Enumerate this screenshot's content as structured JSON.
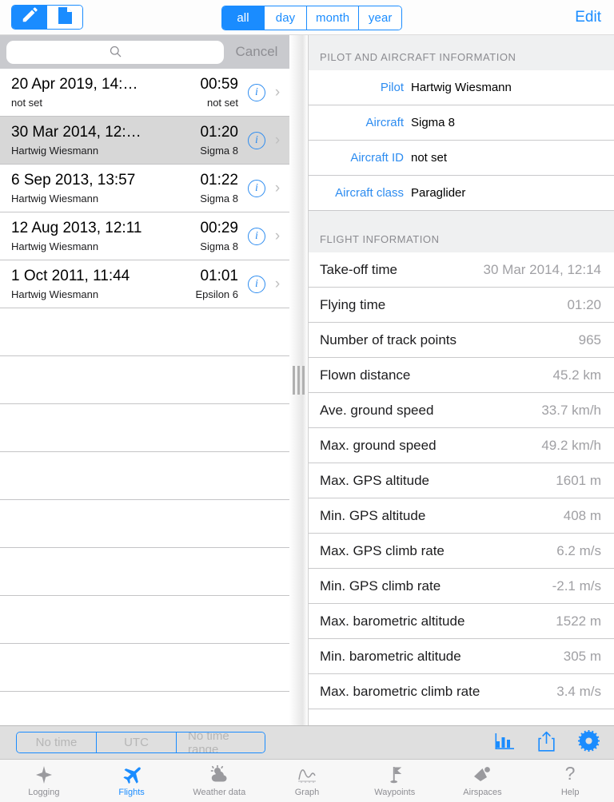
{
  "topbar": {
    "mode_segments": [
      {
        "icon": "pencil-icon",
        "selected": true
      },
      {
        "icon": "document-icon",
        "selected": false
      }
    ],
    "period_segments": [
      {
        "label": "all",
        "selected": true
      },
      {
        "label": "day",
        "selected": false
      },
      {
        "label": "month",
        "selected": false
      },
      {
        "label": "year",
        "selected": false
      }
    ],
    "edit_label": "Edit",
    "accent_color": "#1a8cff"
  },
  "search": {
    "value": "",
    "placeholder": "",
    "icon": "search-icon",
    "cancel_label": "Cancel"
  },
  "flight_list": {
    "rows": [
      {
        "title": "20 Apr 2019, 14:…",
        "subtitle": "not set",
        "duration": "00:59",
        "aircraft": "not set",
        "selected": false
      },
      {
        "title": "30 Mar 2014, 12:…",
        "subtitle": "Hartwig Wiesmann",
        "duration": "01:20",
        "aircraft": "Sigma 8",
        "selected": true
      },
      {
        "title": "6 Sep 2013, 13:57",
        "subtitle": "Hartwig Wiesmann",
        "duration": "01:22",
        "aircraft": "Sigma 8",
        "selected": false
      },
      {
        "title": "12 Aug 2013, 12:11",
        "subtitle": "Hartwig Wiesmann",
        "duration": "00:29",
        "aircraft": "Sigma 8",
        "selected": false
      },
      {
        "title": "1 Oct 2011, 11:44",
        "subtitle": "Hartwig Wiesmann",
        "duration": "01:01",
        "aircraft": "Epsilon 6",
        "selected": false
      }
    ],
    "empty_row_count": 9,
    "info_icon": "info-circle-icon",
    "chevron_icon": "chevron-right-icon",
    "selected_row_color": "#d7d7d7"
  },
  "detail": {
    "pilot_section": {
      "header": "PILOT AND AIRCRAFT INFORMATION",
      "rows": [
        {
          "label": "Pilot",
          "value": "Hartwig Wiesmann"
        },
        {
          "label": "Aircraft",
          "value": "Sigma 8"
        },
        {
          "label": "Aircraft ID",
          "value": "not set"
        },
        {
          "label": "Aircraft class",
          "value": "Paraglider"
        }
      ]
    },
    "flight_section": {
      "header": "FLIGHT INFORMATION",
      "rows": [
        {
          "label": "Take-off time",
          "value": "30 Mar 2014, 12:14"
        },
        {
          "label": "Flying time",
          "value": "01:20"
        },
        {
          "label": "Number of track points",
          "value": "965"
        },
        {
          "label": "Flown distance",
          "value": "45.2 km"
        },
        {
          "label": "Ave. ground speed",
          "value": "33.7 km/h"
        },
        {
          "label": "Max. ground speed",
          "value": "49.2 km/h"
        },
        {
          "label": "Max. GPS altitude",
          "value": "1601 m"
        },
        {
          "label": "Min. GPS altitude",
          "value": "408 m"
        },
        {
          "label": "Max. GPS climb rate",
          "value": "6.2 m/s"
        },
        {
          "label": "Min. GPS climb rate",
          "value": "-2.1 m/s"
        },
        {
          "label": "Max. barometric altitude",
          "value": "1522 m"
        },
        {
          "label": "Min. barometric altitude",
          "value": "305 m"
        },
        {
          "label": "Max. barometric climb rate",
          "value": "3.4 m/s"
        }
      ]
    }
  },
  "bottom_toolbar": {
    "time_segments": [
      {
        "label": "No time"
      },
      {
        "label": "UTC"
      },
      {
        "label": "No time range"
      }
    ],
    "icons": [
      {
        "name": "bar-chart-icon"
      },
      {
        "name": "share-export-icon"
      },
      {
        "name": "gear-icon"
      }
    ]
  },
  "tabbar": {
    "tabs": [
      {
        "label": "Logging",
        "icon": "compass-star-icon",
        "active": false
      },
      {
        "label": "Flights",
        "icon": "airplane-icon",
        "active": true
      },
      {
        "label": "Weather data",
        "icon": "cloud-sun-icon",
        "active": false
      },
      {
        "label": "Graph",
        "icon": "line-graph-icon",
        "active": false
      },
      {
        "label": "Waypoints",
        "icon": "flag-icon",
        "active": false
      },
      {
        "label": "Airspaces",
        "icon": "airspace-icon",
        "active": false
      },
      {
        "label": "Help",
        "icon": "question-mark-icon",
        "active": false
      }
    ]
  }
}
